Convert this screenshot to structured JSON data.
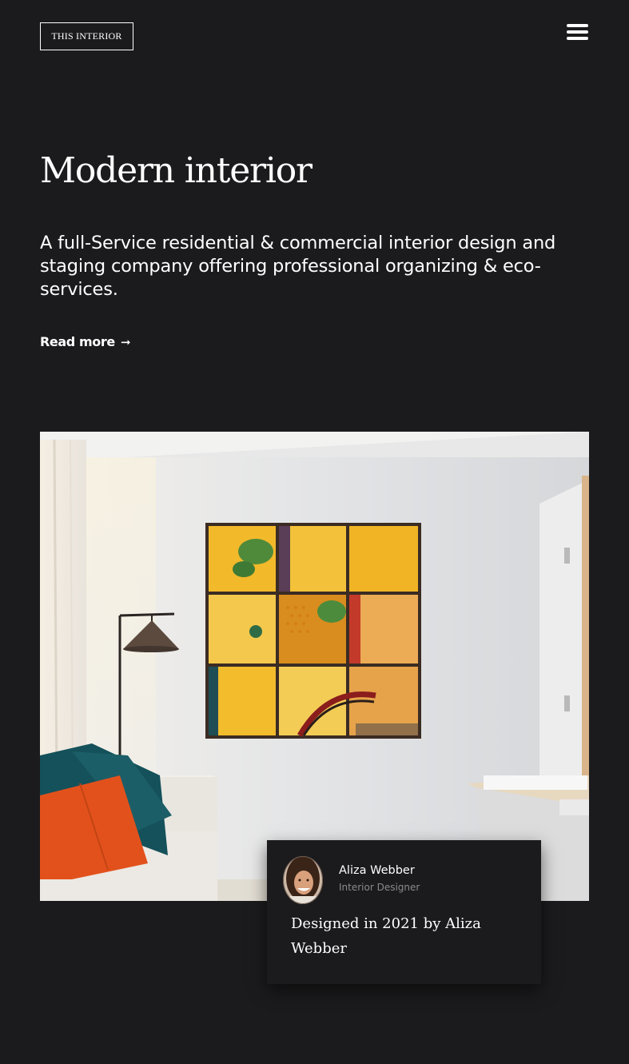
{
  "header": {
    "logo_text": "THIS INTERIOR",
    "menu_icon": "hamburger-menu-icon"
  },
  "hero": {
    "title": "Modern interior",
    "description": "A full-Service residential & commercial interior design and staging company offering professional organizing & eco-services.",
    "read_more_label": "Read more",
    "read_more_icon": "arrow-right-icon",
    "read_more_arrow": "➞"
  },
  "featured": {
    "image_subject": "living room with yellow window-pane wall art, floor lamp and sofa",
    "author": {
      "name": "Aliza Webber",
      "role": "Interior Designer"
    },
    "caption": "Designed in 2021 by Aliza Webber"
  },
  "colors": {
    "background": "#1b1b1d",
    "text": "#ffffff",
    "muted": "#8a8a8e",
    "art_yellow": "#f0b92c",
    "pillow_orange": "#e2511c",
    "pillow_teal": "#1c5c62"
  }
}
